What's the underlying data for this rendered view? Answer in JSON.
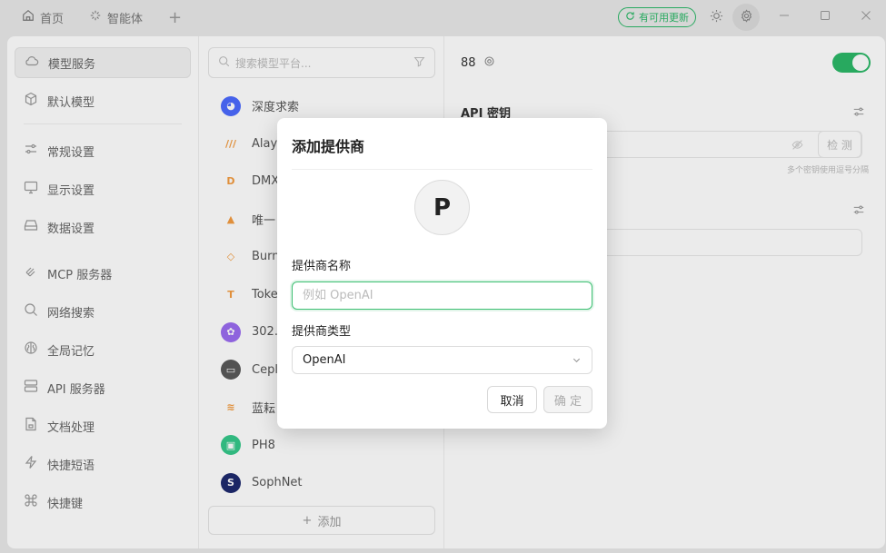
{
  "titlebar": {
    "tabs": [
      {
        "label": "首页",
        "icon": "home-icon"
      },
      {
        "label": "智能体",
        "icon": "sparkle-icon"
      }
    ],
    "update_badge": "有可用更新"
  },
  "nav": {
    "items": [
      {
        "label": "模型服务",
        "icon": "cloud-icon",
        "active": true
      },
      {
        "label": "默认模型",
        "icon": "cube-icon"
      },
      {
        "label": "常规设置",
        "icon": "sliders-icon"
      },
      {
        "label": "显示设置",
        "icon": "monitor-icon"
      },
      {
        "label": "数据设置",
        "icon": "hard-drive-icon"
      },
      {
        "label": "MCP 服务器",
        "icon": "mcp-icon"
      },
      {
        "label": "网络搜索",
        "icon": "search-icon"
      },
      {
        "label": "全局记忆",
        "icon": "brain-icon"
      },
      {
        "label": "API 服务器",
        "icon": "server-icon"
      },
      {
        "label": "文档处理",
        "icon": "document-icon"
      },
      {
        "label": "快捷短语",
        "icon": "zap-icon"
      },
      {
        "label": "快捷键",
        "icon": "command-icon"
      }
    ]
  },
  "providers": {
    "search_placeholder": "搜索模型平台...",
    "items": [
      {
        "label": "深度求索",
        "color": "#4d6bfe",
        "glyph": "◕"
      },
      {
        "label": "Alaya",
        "color": "#ffffff",
        "glyph": "///"
      },
      {
        "label": "DMX",
        "color": "#ffffff",
        "glyph": "D"
      },
      {
        "label": "唯一",
        "color": "#ffffff",
        "glyph": "▲"
      },
      {
        "label": "Burn",
        "color": "#ffffff",
        "glyph": "◇"
      },
      {
        "label": "Toke",
        "color": "#ffffff",
        "glyph": "T"
      },
      {
        "label": "302.",
        "color": "#9b6cf0",
        "glyph": "✿"
      },
      {
        "label": "Cepl",
        "color": "#5a5a5a",
        "glyph": "▭"
      },
      {
        "label": "蓝耘",
        "color": "#ffffff",
        "glyph": "≋"
      },
      {
        "label": "PH8",
        "color": "#36c88a",
        "glyph": "▣"
      },
      {
        "label": "SophNet",
        "color": "#1e2a6e",
        "glyph": "S"
      }
    ],
    "add_label": "添加"
  },
  "detail": {
    "name": "88",
    "section_title": "API 密钥",
    "check_label": "检 测",
    "key_hint": "多个密钥使用逗号分隔"
  },
  "modal": {
    "title": "添加提供商",
    "avatar_letter": "P",
    "name_label": "提供商名称",
    "name_placeholder": "例如 OpenAI",
    "type_label": "提供商类型",
    "type_value": "OpenAI",
    "cancel_label": "取消",
    "ok_label": "确 定"
  },
  "colors": {
    "accent": "#2cb868",
    "focus_border": "#3dbf72"
  }
}
